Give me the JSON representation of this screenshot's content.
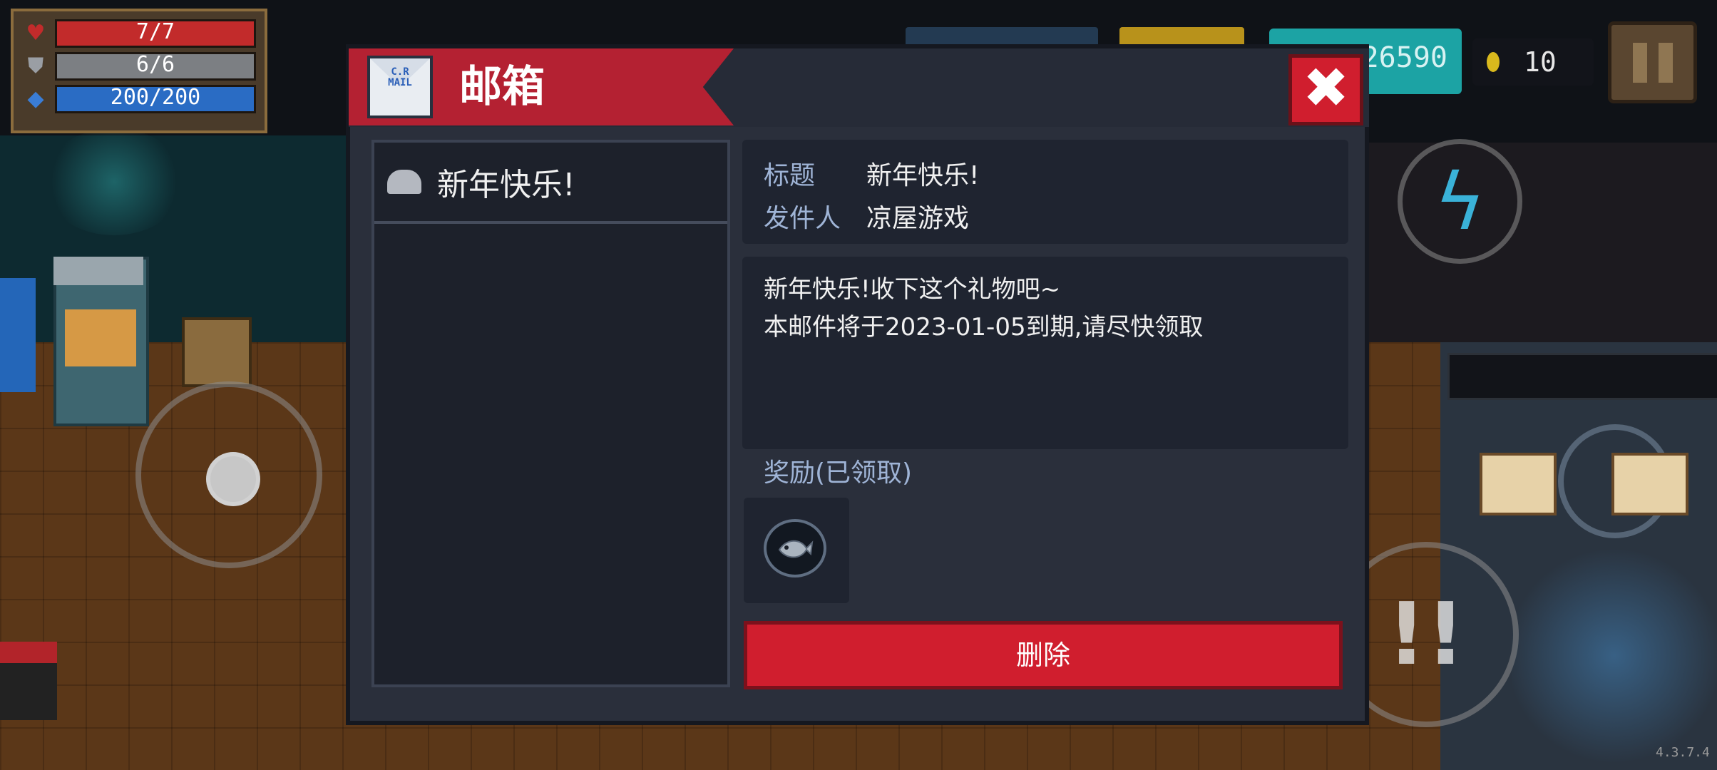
{
  "hud": {
    "hp": "7/7",
    "armor": "6/6",
    "energy": "200/200",
    "icons": {
      "hp": "heart-icon",
      "armor": "shield-icon",
      "energy": "diamond-icon"
    }
  },
  "top_right": {
    "gems": "26590",
    "coins": "10"
  },
  "mailbox": {
    "title": "邮箱",
    "close_label": "✖",
    "mails": [
      {
        "title": "新年快乐!",
        "icon": "envelope-open-icon"
      }
    ],
    "detail": {
      "subject_key": "标题",
      "subject": "新年快乐!",
      "sender_key": "发件人",
      "sender": "凉屋游戏",
      "body_line1": "新年快乐!收下这个礼物吧~",
      "body_line2": "本邮件将于2023-01-05到期,请尽快领取"
    },
    "reward_label": "奖励(已领取)",
    "reward_item": "fish-icon",
    "delete_label": "删除"
  },
  "version": "4.3.7.4",
  "colors": {
    "ribbon_red": "#b42132",
    "button_red": "#d01e2e",
    "panel_dark": "#1f2430",
    "label_blue": "#9fb4d6"
  }
}
